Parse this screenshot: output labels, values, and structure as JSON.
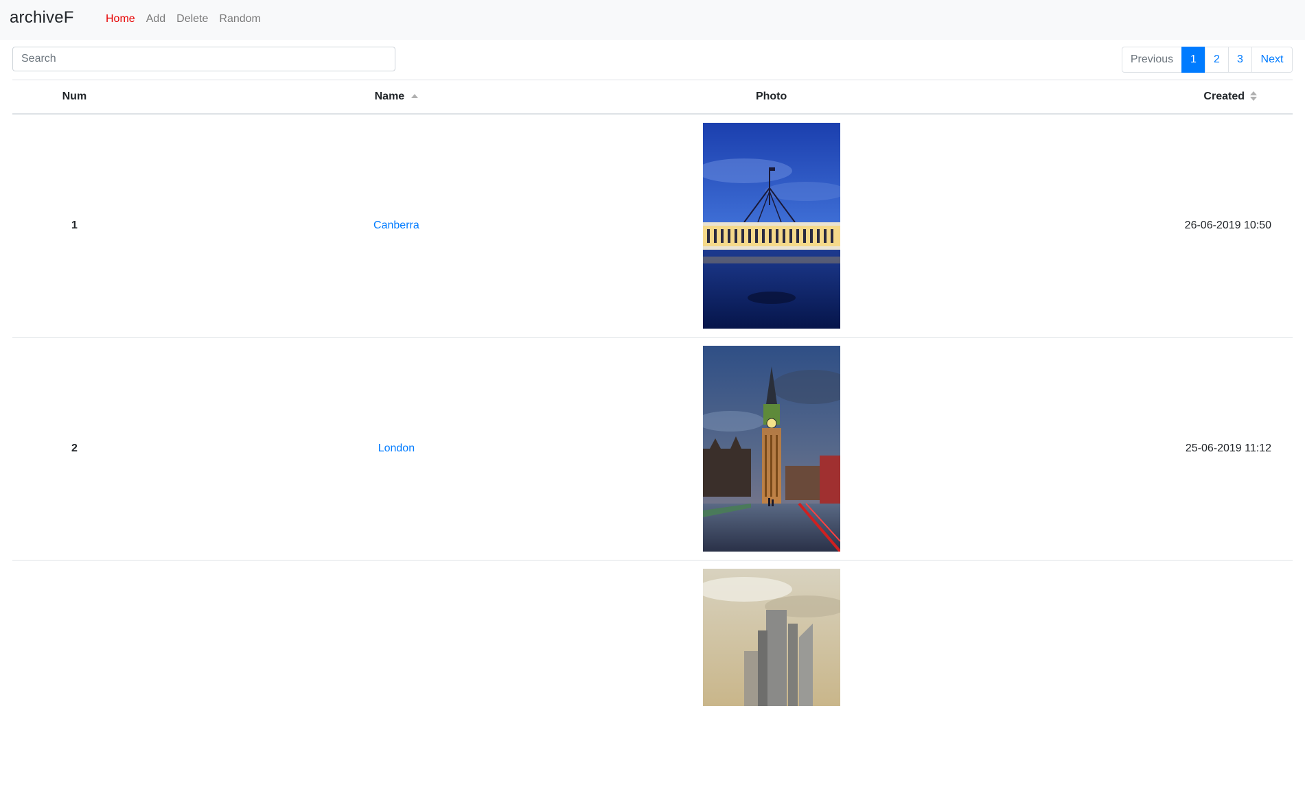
{
  "brand": "archiveF",
  "nav": {
    "home": "Home",
    "add": "Add",
    "delete": "Delete",
    "random": "Random"
  },
  "search": {
    "placeholder": "Search"
  },
  "pagination": {
    "previous": "Previous",
    "pages": [
      "1",
      "2",
      "3"
    ],
    "next": "Next",
    "active_page": "1"
  },
  "table": {
    "headers": {
      "num": "Num",
      "name": "Name",
      "photo": "Photo",
      "created": "Created"
    },
    "rows": [
      {
        "num": "1",
        "name": "Canberra",
        "created": "26-06-2019 10:50"
      },
      {
        "num": "2",
        "name": "London",
        "created": "25-06-2019 11:12"
      },
      {
        "num": "",
        "name": "",
        "created": ""
      }
    ]
  },
  "colors": {
    "accent": "#007bff",
    "active_nav": "#e60000",
    "navbar_bg": "#f8f9fa"
  }
}
